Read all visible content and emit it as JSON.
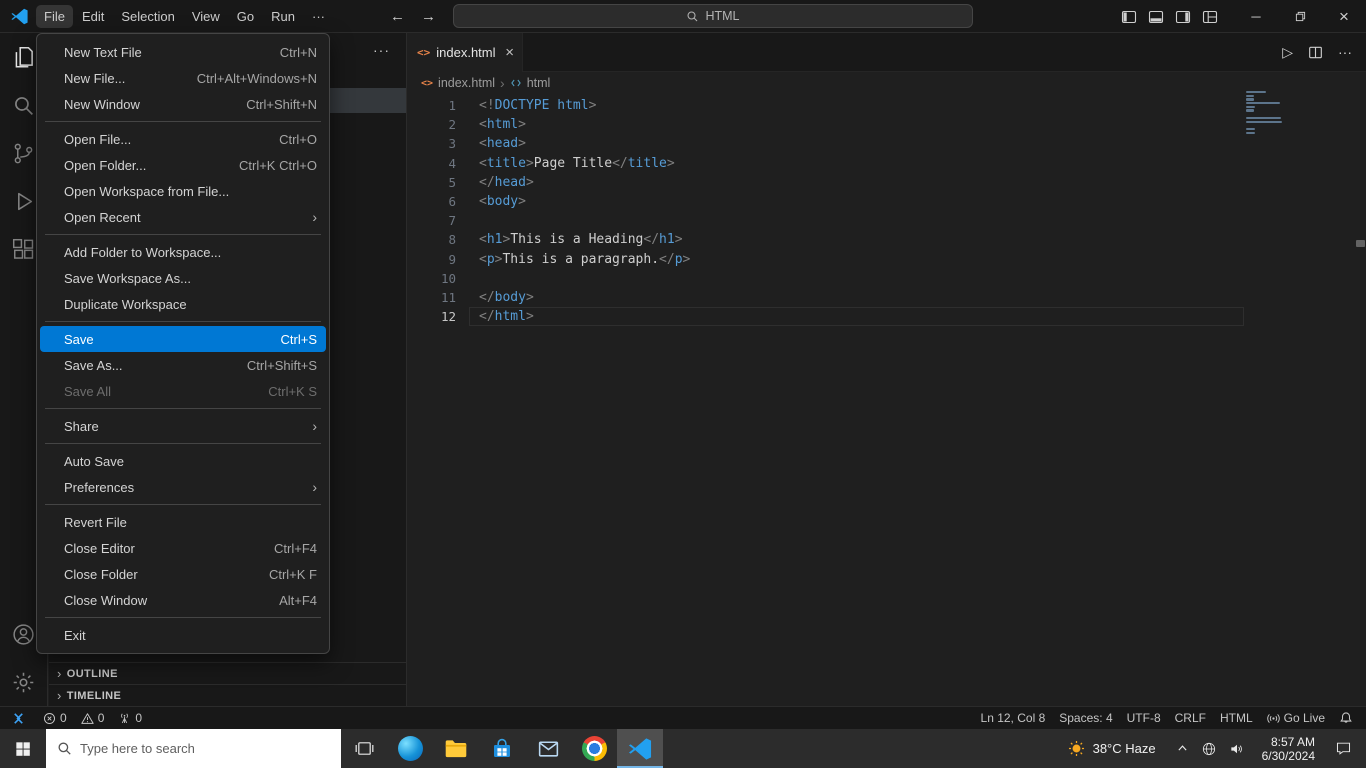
{
  "icons": {
    "back": "←",
    "forward": "→",
    "minimize": "─",
    "close": "×",
    "more": "···",
    "chevron": "›",
    "play": "▷",
    "html_glyph": "<>"
  },
  "titlebar": {
    "menus": [
      {
        "label": "File",
        "active": true
      },
      {
        "label": "Edit"
      },
      {
        "label": "Selection"
      },
      {
        "label": "View"
      },
      {
        "label": "Go"
      },
      {
        "label": "Run"
      },
      {
        "label": "···"
      }
    ],
    "search_text": "HTML"
  },
  "file_menu": {
    "groups": [
      {
        "items": [
          {
            "label": "New Text File",
            "shortcut": "Ctrl+N"
          },
          {
            "label": "New File...",
            "shortcut": "Ctrl+Alt+Windows+N"
          },
          {
            "label": "New Window",
            "shortcut": "Ctrl+Shift+N"
          }
        ]
      },
      {
        "items": [
          {
            "label": "Open File...",
            "shortcut": "Ctrl+O"
          },
          {
            "label": "Open Folder...",
            "shortcut": "Ctrl+K Ctrl+O"
          },
          {
            "label": "Open Workspace from File..."
          },
          {
            "label": "Open Recent",
            "submenu": true
          }
        ]
      },
      {
        "items": [
          {
            "label": "Add Folder to Workspace..."
          },
          {
            "label": "Save Workspace As..."
          },
          {
            "label": "Duplicate Workspace"
          }
        ]
      },
      {
        "items": [
          {
            "label": "Save",
            "shortcut": "Ctrl+S",
            "selected": true
          },
          {
            "label": "Save As...",
            "shortcut": "Ctrl+Shift+S"
          },
          {
            "label": "Save All",
            "shortcut": "Ctrl+K S",
            "disabled": true
          }
        ]
      },
      {
        "items": [
          {
            "label": "Share",
            "submenu": true
          }
        ]
      },
      {
        "items": [
          {
            "label": "Auto Save"
          },
          {
            "label": "Preferences",
            "submenu": true
          }
        ]
      },
      {
        "items": [
          {
            "label": "Revert File"
          },
          {
            "label": "Close Editor",
            "shortcut": "Ctrl+F4"
          },
          {
            "label": "Close Folder",
            "shortcut": "Ctrl+K F"
          },
          {
            "label": "Close Window",
            "shortcut": "Alt+F4"
          }
        ]
      },
      {
        "items": [
          {
            "label": "Exit"
          }
        ]
      }
    ]
  },
  "activity_bar": {
    "top": [
      {
        "id": "explorer",
        "active": true
      },
      {
        "id": "search"
      },
      {
        "id": "source-control"
      },
      {
        "id": "run-debug"
      },
      {
        "id": "extensions"
      }
    ],
    "bottom": [
      {
        "id": "accounts"
      },
      {
        "id": "settings"
      }
    ]
  },
  "sidebar": {
    "more_actions": "···",
    "sections": [
      {
        "label": "OUTLINE"
      },
      {
        "label": "TIMELINE"
      }
    ]
  },
  "editor": {
    "tab": {
      "label": "index.html"
    },
    "breadcrumbs": [
      {
        "label": "index.html"
      },
      {
        "label": "html"
      }
    ],
    "active_line": 12,
    "lines": [
      {
        "n": 1,
        "tokens": [
          [
            "p",
            "<!"
          ],
          [
            "t",
            "DOCTYPE html"
          ],
          [
            "p",
            ">"
          ]
        ]
      },
      {
        "n": 2,
        "tokens": [
          [
            "p",
            "<"
          ],
          [
            "t",
            "html"
          ],
          [
            "p",
            ">"
          ]
        ]
      },
      {
        "n": 3,
        "tokens": [
          [
            "p",
            "<"
          ],
          [
            "t",
            "head"
          ],
          [
            "p",
            ">"
          ]
        ]
      },
      {
        "n": 4,
        "tokens": [
          [
            "p",
            "<"
          ],
          [
            "t",
            "title"
          ],
          [
            "p",
            ">"
          ],
          [
            "x",
            "Page Title"
          ],
          [
            "p",
            "</"
          ],
          [
            "t",
            "title"
          ],
          [
            "p",
            ">"
          ]
        ]
      },
      {
        "n": 5,
        "tokens": [
          [
            "p",
            "</"
          ],
          [
            "t",
            "head"
          ],
          [
            "p",
            ">"
          ]
        ]
      },
      {
        "n": 6,
        "tokens": [
          [
            "p",
            "<"
          ],
          [
            "t",
            "body"
          ],
          [
            "p",
            ">"
          ]
        ]
      },
      {
        "n": 7,
        "tokens": []
      },
      {
        "n": 8,
        "tokens": [
          [
            "p",
            "<"
          ],
          [
            "t",
            "h1"
          ],
          [
            "p",
            ">"
          ],
          [
            "x",
            "This is a Heading"
          ],
          [
            "p",
            "</"
          ],
          [
            "t",
            "h1"
          ],
          [
            "p",
            ">"
          ]
        ]
      },
      {
        "n": 9,
        "tokens": [
          [
            "p",
            "<"
          ],
          [
            "t",
            "p"
          ],
          [
            "p",
            ">"
          ],
          [
            "x",
            "This is a paragraph."
          ],
          [
            "p",
            "</"
          ],
          [
            "t",
            "p"
          ],
          [
            "p",
            ">"
          ]
        ]
      },
      {
        "n": 10,
        "tokens": []
      },
      {
        "n": 11,
        "tokens": [
          [
            "p",
            "</"
          ],
          [
            "t",
            "body"
          ],
          [
            "p",
            ">"
          ]
        ]
      },
      {
        "n": 12,
        "tokens": [
          [
            "p",
            "</"
          ],
          [
            "t",
            "html"
          ],
          [
            "p",
            ">"
          ]
        ]
      }
    ]
  },
  "status_bar": {
    "left": [
      {
        "id": "remote",
        "icon": "remote"
      },
      {
        "id": "errors",
        "icon": "error",
        "label": "0"
      },
      {
        "id": "warnings",
        "icon": "warning",
        "label": "0"
      },
      {
        "id": "ports",
        "icon": "tower",
        "label": "0"
      }
    ],
    "right": [
      {
        "id": "cursor-position",
        "label": "Ln 12, Col 8"
      },
      {
        "id": "indentation",
        "label": "Spaces: 4"
      },
      {
        "id": "encoding",
        "label": "UTF-8"
      },
      {
        "id": "eol",
        "label": "CRLF"
      },
      {
        "id": "language-mode",
        "label": "HTML"
      },
      {
        "id": "go-live",
        "icon": "broadcast",
        "label": "Go Live"
      },
      {
        "id": "notifications",
        "icon": "bell"
      }
    ]
  },
  "taskbar": {
    "search_placeholder": "Type here to search",
    "apps": [
      {
        "id": "task-view"
      },
      {
        "id": "edge"
      },
      {
        "id": "file-explorer"
      },
      {
        "id": "store"
      },
      {
        "id": "mail"
      },
      {
        "id": "chrome"
      },
      {
        "id": "vscode",
        "active": true
      }
    ],
    "tray": {
      "weather": "38°C Haze",
      "time": "8:57 AM",
      "date": "6/30/2024"
    }
  }
}
